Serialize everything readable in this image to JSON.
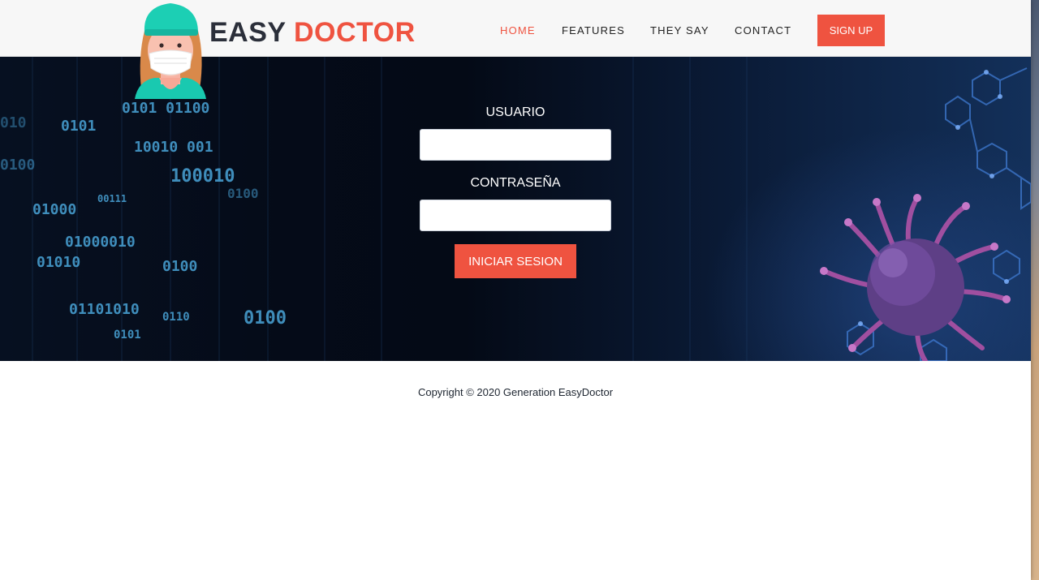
{
  "brand": {
    "word1": "EASY",
    "word2": "DOCTOR"
  },
  "nav": {
    "items": [
      {
        "label": "HOME",
        "active": true
      },
      {
        "label": "FEATURES",
        "active": false
      },
      {
        "label": "THEY SAY",
        "active": false
      },
      {
        "label": "CONTACT",
        "active": false
      }
    ],
    "signup_label": "SIGN UP"
  },
  "login": {
    "user_label": "USUARIO",
    "user_value": "",
    "password_label": "CONTRASEÑA",
    "password_value": "",
    "submit_label": "INICIAR SESION"
  },
  "footer": {
    "copyright": "Copyright © 2020 Generation EasyDoctor"
  },
  "colors": {
    "accent": "#ef5340",
    "dark_text": "#2b2f3a",
    "hero_bg": "#061021"
  },
  "icons": {
    "mascot": "doctor-with-mask-icon",
    "virus": "virus-illustration"
  }
}
